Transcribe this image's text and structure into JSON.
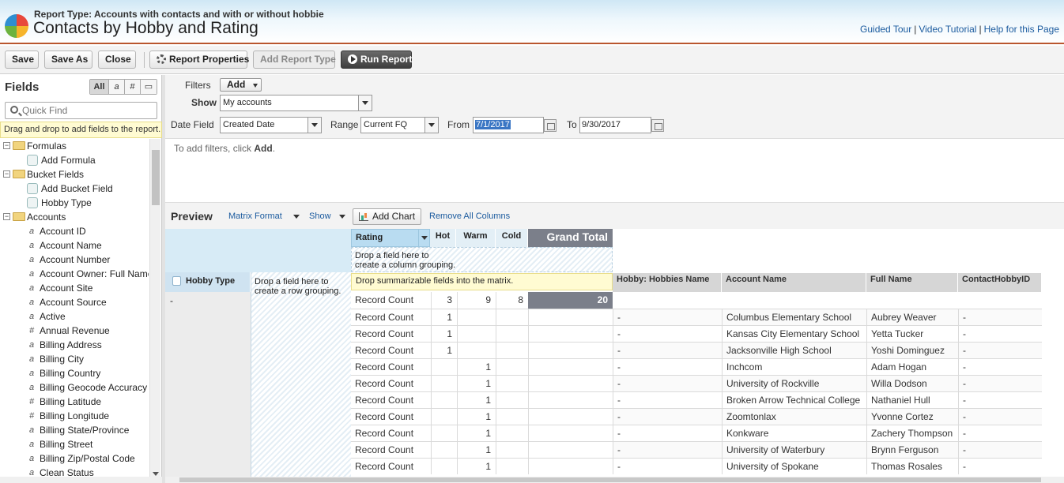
{
  "header": {
    "report_type": "Report Type: Accounts with contacts and with or without hobbie",
    "title": "Contacts by Hobby and Rating",
    "links": [
      "Guided Tour",
      "Video Tutorial",
      "Help for this Page"
    ]
  },
  "toolbar": {
    "save": "Save",
    "save_as": "Save As",
    "close": "Close",
    "report_properties": "Report Properties",
    "add_report_type": "Add Report Type",
    "run_report": "Run Report"
  },
  "fields_panel": {
    "title": "Fields",
    "filters": [
      "All",
      "a",
      "#",
      "▭"
    ],
    "quick_find_placeholder": "Quick Find",
    "drag_hint": "Drag and drop to add fields to the report.",
    "tree": [
      {
        "type": "folder",
        "label": "Formulas"
      },
      {
        "type": "sub",
        "label": "Add Formula"
      },
      {
        "type": "folder",
        "label": "Bucket Fields"
      },
      {
        "type": "sub",
        "label": "Add Bucket Field"
      },
      {
        "type": "sub",
        "label": "Hobby Type"
      },
      {
        "type": "folder",
        "label": "Accounts"
      },
      {
        "type": "text",
        "label": "Account ID"
      },
      {
        "type": "text",
        "label": "Account Name"
      },
      {
        "type": "text",
        "label": "Account Number"
      },
      {
        "type": "text",
        "label": "Account Owner: Full Name"
      },
      {
        "type": "text",
        "label": "Account Site"
      },
      {
        "type": "text",
        "label": "Account Source"
      },
      {
        "type": "text",
        "label": "Active"
      },
      {
        "type": "number",
        "label": "Annual Revenue"
      },
      {
        "type": "text",
        "label": "Billing Address"
      },
      {
        "type": "text",
        "label": "Billing City"
      },
      {
        "type": "text",
        "label": "Billing Country"
      },
      {
        "type": "text",
        "label": "Billing Geocode Accuracy"
      },
      {
        "type": "number",
        "label": "Billing Latitude"
      },
      {
        "type": "number",
        "label": "Billing Longitude"
      },
      {
        "type": "text",
        "label": "Billing State/Province"
      },
      {
        "type": "text",
        "label": "Billing Street"
      },
      {
        "type": "text",
        "label": "Billing Zip/Postal Code"
      },
      {
        "type": "text",
        "label": "Clean Status"
      }
    ]
  },
  "filters": {
    "filters_label": "Filters",
    "add_label": "Add",
    "show_label": "Show",
    "show_value": "My accounts",
    "date_field_label": "Date Field",
    "date_field_value": "Created Date",
    "range_label": "Range",
    "range_value": "Current FQ",
    "from_label": "From",
    "from_value": "7/1/2017",
    "to_label": "To",
    "to_value": "9/30/2017",
    "message_prefix": "To add filters, click ",
    "message_bold": "Add",
    "message_suffix": "."
  },
  "preview": {
    "title": "Preview",
    "format": "Matrix Format",
    "show": "Show",
    "add_chart": "Add Chart",
    "remove_all": "Remove All Columns"
  },
  "matrix": {
    "rating_label": "Rating",
    "columns": [
      "Hot",
      "Warm",
      "Cold"
    ],
    "grand_total": "Grand Total",
    "drop_column": [
      "Drop a field here to",
      "create a column grouping."
    ],
    "drop_row": [
      "Drop a field here to",
      "create a row grouping."
    ],
    "drop_summary": "Drop summarizable fields into the matrix.",
    "row_group_label": "Hobby Type",
    "row_group_value": "-",
    "detail_headers": [
      "Hobby: Hobbies Name",
      "Account Name",
      "Full Name",
      "ContactHobbyID"
    ],
    "summary_row": {
      "label": "Record Count",
      "hot": "3",
      "warm": "9",
      "cold": "8",
      "total": "20"
    },
    "rows": [
      {
        "label": "Record Count",
        "hot": "1",
        "warm": "",
        "cold": "",
        "hobby": "-",
        "account": "Columbus Elementary School",
        "name": "Aubrey Weaver",
        "id": "-"
      },
      {
        "label": "Record Count",
        "hot": "1",
        "warm": "",
        "cold": "",
        "hobby": "-",
        "account": "Kansas City Elementary School",
        "name": "Yetta Tucker",
        "id": "-"
      },
      {
        "label": "Record Count",
        "hot": "1",
        "warm": "",
        "cold": "",
        "hobby": "-",
        "account": "Jacksonville High School",
        "name": "Yoshi Dominguez",
        "id": "-"
      },
      {
        "label": "Record Count",
        "hot": "",
        "warm": "1",
        "cold": "",
        "hobby": "-",
        "account": "Inchcom",
        "name": "Adam Hogan",
        "id": "-"
      },
      {
        "label": "Record Count",
        "hot": "",
        "warm": "1",
        "cold": "",
        "hobby": "-",
        "account": "University of Rockville",
        "name": "Willa Dodson",
        "id": "-"
      },
      {
        "label": "Record Count",
        "hot": "",
        "warm": "1",
        "cold": "",
        "hobby": "-",
        "account": "Broken Arrow Technical College",
        "name": "Nathaniel Hull",
        "id": "-"
      },
      {
        "label": "Record Count",
        "hot": "",
        "warm": "1",
        "cold": "",
        "hobby": "-",
        "account": "Zoomtonlax",
        "name": "Yvonne Cortez",
        "id": "-"
      },
      {
        "label": "Record Count",
        "hot": "",
        "warm": "1",
        "cold": "",
        "hobby": "-",
        "account": "Konkware",
        "name": "Zachery Thompson",
        "id": "-"
      },
      {
        "label": "Record Count",
        "hot": "",
        "warm": "1",
        "cold": "",
        "hobby": "-",
        "account": "University of Waterbury",
        "name": "Brynn Ferguson",
        "id": "-"
      },
      {
        "label": "Record Count",
        "hot": "",
        "warm": "1",
        "cold": "",
        "hobby": "-",
        "account": "University of Spokane",
        "name": "Thomas Rosales",
        "id": "-"
      }
    ]
  }
}
